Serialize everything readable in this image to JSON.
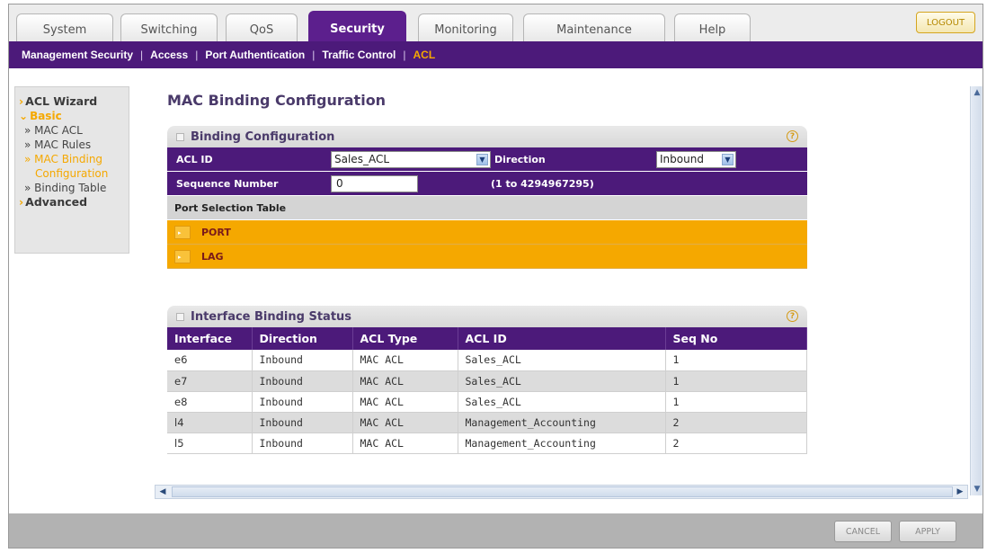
{
  "tabs": [
    {
      "label": "System"
    },
    {
      "label": "Switching"
    },
    {
      "label": "QoS"
    },
    {
      "label": "Security"
    },
    {
      "label": "Monitoring"
    },
    {
      "label": "Maintenance"
    },
    {
      "label": "Help"
    }
  ],
  "logout_label": "LOGOUT",
  "subnav": [
    {
      "label": "Management Security"
    },
    {
      "label": "Access"
    },
    {
      "label": "Port Authentication"
    },
    {
      "label": "Traffic Control"
    },
    {
      "label": "ACL"
    }
  ],
  "leftnav": {
    "acl_wizard": "ACL Wizard",
    "basic": "Basic",
    "mac_acl": "MAC ACL",
    "mac_rules": "MAC Rules",
    "mac_binding_1": "MAC Binding",
    "mac_binding_2": "Configuration",
    "binding_table": "Binding Table",
    "advanced": "Advanced"
  },
  "page_title": "MAC Binding Configuration",
  "binding_config": {
    "title": "Binding Configuration",
    "acl_id_label": "ACL ID",
    "acl_id_value": "Sales_ACL",
    "direction_label": "Direction",
    "direction_value": "Inbound",
    "seq_label": "Sequence Number",
    "seq_value": "0",
    "seq_range": "(1 to 4294967295)",
    "port_table_label": "Port Selection Table",
    "port_label": "PORT",
    "lag_label": "LAG"
  },
  "status": {
    "title": "Interface Binding Status",
    "columns": [
      "Interface",
      "Direction",
      "ACL Type",
      "ACL ID",
      "Seq No"
    ],
    "rows": [
      [
        "e6",
        "Inbound",
        "MAC ACL",
        "Sales_ACL",
        "1"
      ],
      [
        "e7",
        "Inbound",
        "MAC ACL",
        "Sales_ACL",
        "1"
      ],
      [
        "e8",
        "Inbound",
        "MAC ACL",
        "Sales_ACL",
        "1"
      ],
      [
        "l4",
        "Inbound",
        "MAC ACL",
        "Management_Accounting",
        "2"
      ],
      [
        "l5",
        "Inbound",
        "MAC ACL",
        "Management_Accounting",
        "2"
      ]
    ]
  },
  "footer": {
    "cancel_label": "CANCEL",
    "apply_label": "APPLY"
  },
  "colors": {
    "purple": "#4c1a7a",
    "orange": "#f5a800",
    "tab_active": "#5c1f8d"
  }
}
